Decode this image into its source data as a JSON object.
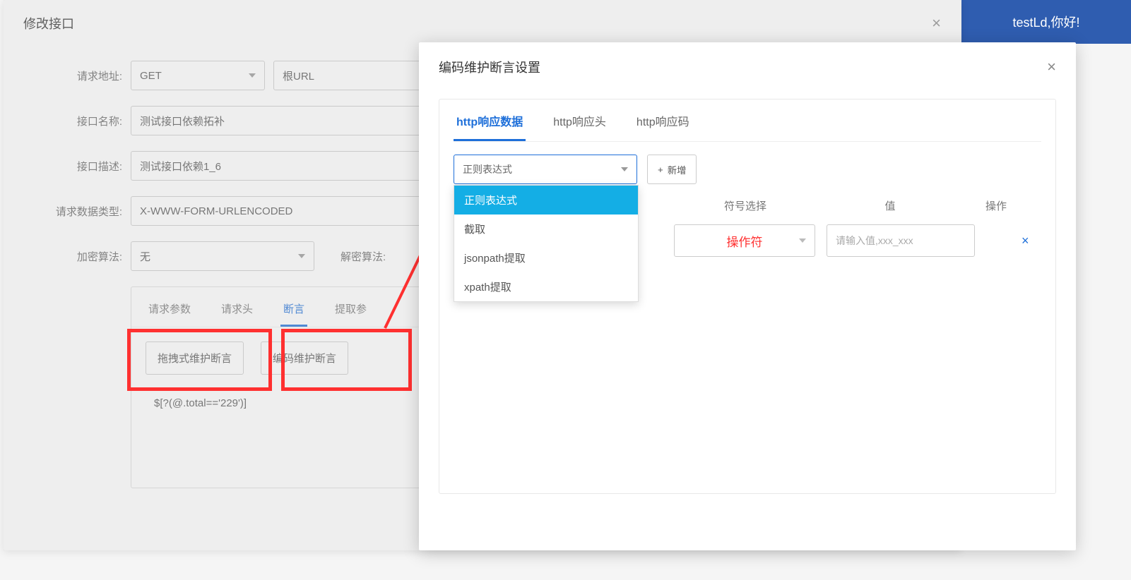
{
  "header": {
    "greeting": "testLd,你好!"
  },
  "main_dialog": {
    "title": "修改接口",
    "labels": {
      "url": "请求地址:",
      "name": "接口名称:",
      "desc": "接口描述:",
      "type": "请求数据类型:",
      "enc": "加密算法:",
      "dec": "解密算法:"
    },
    "values": {
      "method": "GET",
      "url": "根URL",
      "name": "测试接口依赖拓补",
      "desc": "测试接口依赖1_6",
      "type": "X-WWW-FORM-URLENCODED",
      "enc": "无"
    },
    "tabs": [
      "请求参数",
      "请求头",
      "断言",
      "提取参"
    ],
    "active_tab": "断言",
    "buttons": {
      "drag_assert": "拖拽式维护断言",
      "code_assert": "编码维护断言"
    },
    "assert_expr": "$[?(@.total=='229')]"
  },
  "inner_dialog": {
    "title": "编码维护断言设置",
    "tabs": [
      "http响应数据",
      "http响应头",
      "http响应码"
    ],
    "active_tab": "http响应数据",
    "expr_select_value": "正则表达式",
    "expr_options": [
      "正则表达式",
      "截取",
      "jsonpath提取",
      "xpath提取"
    ],
    "add_btn": "新增",
    "table_headers": {
      "operator": "符号选择",
      "value": "值",
      "action": "操作"
    },
    "row": {
      "operator": "操作符",
      "value_placeholder": "请输入值,xxx_xxx",
      "delete_icon": "×"
    }
  }
}
